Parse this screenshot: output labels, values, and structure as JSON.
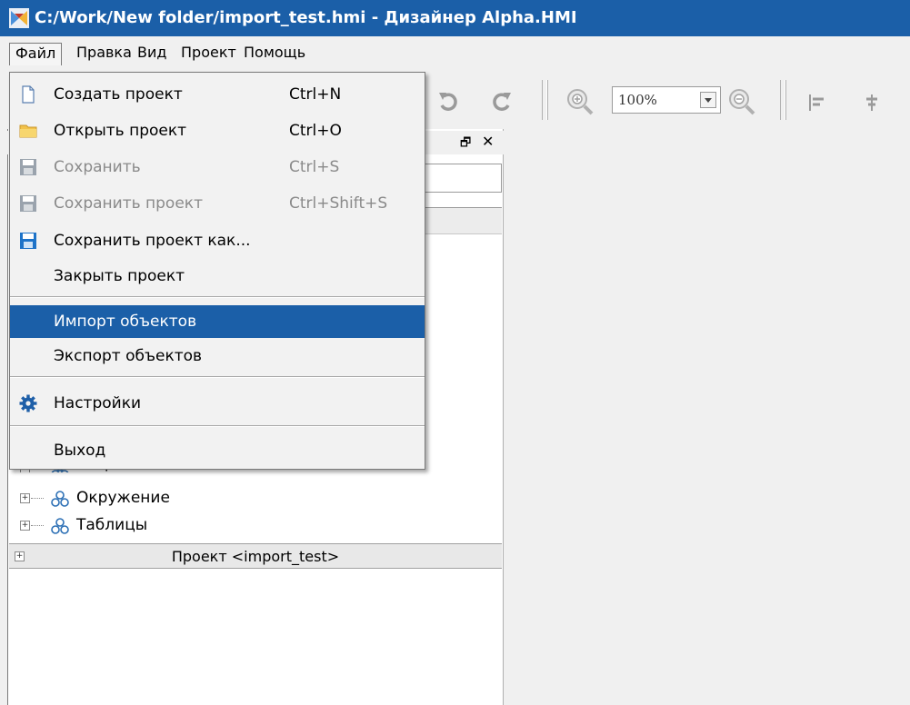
{
  "window": {
    "title": "C:/Work/New folder/import_test.hmi - Дизайнер Alpha.HMI",
    "accent": "#1b5fa8"
  },
  "menubar": {
    "items": [
      {
        "label": "Файл"
      },
      {
        "label": "Правка"
      },
      {
        "label": "Вид"
      },
      {
        "label": "Проект"
      },
      {
        "label": "Помощь"
      }
    ]
  },
  "toolbar": {
    "zoom_value": "100%",
    "icons": [
      "undo-icon",
      "redo-icon",
      "zoom-in-icon",
      "zoom-out-icon",
      "align-left-icon",
      "align-center-icon"
    ]
  },
  "dock": {
    "float_glyph": "🗗",
    "close_glyph": "✕"
  },
  "file_menu": {
    "items": [
      {
        "label": "Создать проект",
        "shortcut": "Ctrl+N",
        "icon": "new-document-icon",
        "enabled": true
      },
      {
        "label": "Открыть проект",
        "shortcut": "Ctrl+O",
        "icon": "folder-icon",
        "enabled": true
      },
      {
        "label": "Сохранить",
        "shortcut": "Ctrl+S",
        "icon": "save-icon",
        "enabled": false
      },
      {
        "label": "Сохранить проект",
        "shortcut": "Ctrl+Shift+S",
        "icon": "save-project-icon",
        "enabled": false
      },
      {
        "label": "Сохранить проект как...",
        "shortcut": "",
        "icon": "save-as-icon",
        "enabled": true
      },
      {
        "label": "Закрыть проект",
        "shortcut": "",
        "icon": "",
        "enabled": true
      },
      {
        "label": "Импорт объектов",
        "shortcut": "",
        "icon": "",
        "enabled": true,
        "selected": true
      },
      {
        "label": "Экспорт объектов",
        "shortcut": "",
        "icon": "",
        "enabled": true
      },
      {
        "label": "Настройки",
        "shortcut": "",
        "icon": "gear-icon",
        "enabled": true
      },
      {
        "label": "Выход",
        "shortcut": "",
        "icon": "",
        "enabled": true
      }
    ]
  },
  "tree": {
    "partial_item": "Встроенные",
    "items": [
      {
        "label": "Окружение",
        "icon": "group-icon"
      },
      {
        "label": "Таблицы",
        "icon": "group-icon"
      }
    ]
  },
  "project_section": {
    "label": "Проект <import_test>"
  }
}
